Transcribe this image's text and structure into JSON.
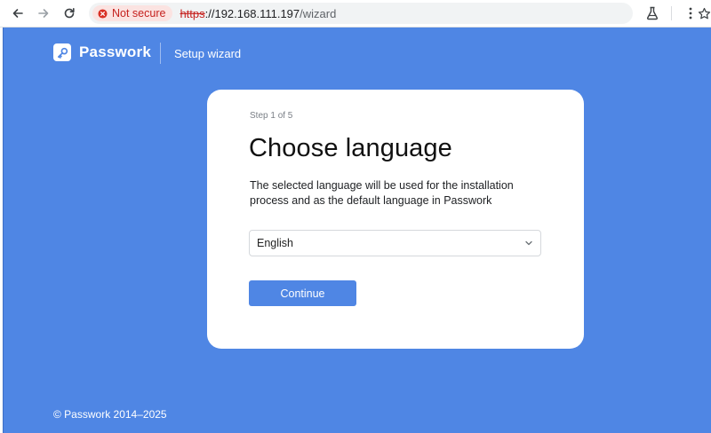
{
  "browser": {
    "security_label": "Not secure",
    "url_scheme": "https",
    "url_host": "://192.168.111.197",
    "url_path": "/wizard",
    "icons": [
      "back-arrow-icon",
      "forward-arrow-icon",
      "reload-icon",
      "warning-icon",
      "bookmark-star-icon",
      "labs-flask-icon",
      "kebab-menu-icon"
    ]
  },
  "app": {
    "brand": "Passwork",
    "subtitle": "Setup wizard",
    "footer": "© Passwork 2014–2025",
    "accent_color": "#4f86e4"
  },
  "wizard": {
    "step": "Step 1 of 5",
    "title": "Choose language",
    "description": "The selected language will be used for the installation process and as the default language in Passwork",
    "language_selected": "English",
    "continue_label": "Continue"
  }
}
